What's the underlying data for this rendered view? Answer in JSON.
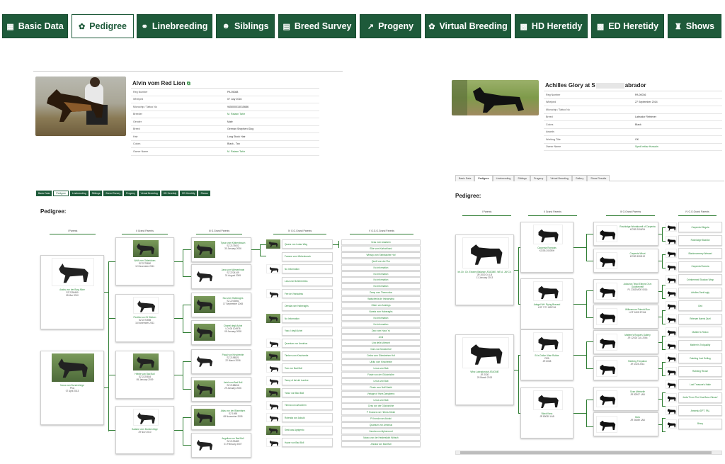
{
  "top_tabs": [
    {
      "label": "Basic Data",
      "icon": "dashboard-icon",
      "active": false
    },
    {
      "label": "Pedigree",
      "icon": "paw-icon",
      "active": true
    },
    {
      "label": "Linebreeding",
      "icon": "link-icon",
      "active": false
    },
    {
      "label": "Siblings",
      "icon": "users-icon",
      "active": false
    },
    {
      "label": "Breed Survey",
      "icon": "book-icon",
      "active": false
    },
    {
      "label": "Progeny",
      "icon": "chart-icon",
      "active": false
    },
    {
      "label": "Virtual Breeding",
      "icon": "paw-icon",
      "active": false
    },
    {
      "label": "HD Heretidy",
      "icon": "sitemap-icon",
      "active": false
    },
    {
      "label": "ED Heretidy",
      "icon": "sitemap-icon",
      "active": false
    },
    {
      "label": "Shows",
      "icon": "trophy-icon",
      "active": false
    }
  ],
  "left": {
    "dog_title": "Alvin vom Red Lion",
    "info": [
      {
        "k": "Reg Number",
        "v": "PA 05088",
        "link": false
      },
      {
        "k": "Whelped",
        "v": "07 July 2016",
        "link": false
      },
      {
        "k": "Microchip / Tattoo No",
        "v": "945000015015686",
        "link": false
      },
      {
        "k": "Breeder",
        "v": "M. Raizan Tahir",
        "link": true
      },
      {
        "k": "Gender",
        "v": "Male",
        "link": false
      },
      {
        "k": "Breed",
        "v": "German Shepherd Dog",
        "link": false
      },
      {
        "k": "Hair",
        "v": "Long Stock Hair",
        "link": false
      },
      {
        "k": "Colors",
        "v": "Black - Tan",
        "link": false
      },
      {
        "k": "Owner Name",
        "v": "M. Raizan Tahir",
        "link": true
      }
    ],
    "tabs": [
      "Basic Data",
      "Pedigree",
      "Linebreeding",
      "Siblings",
      "Breed Survey",
      "Progeny",
      "Virtual Breeding",
      "HD Heretidy",
      "ED Heretidy",
      "Shows"
    ],
    "pedigree_heading": "Pedigree:",
    "gen_labels": [
      "I Parents",
      "II Grand Parents",
      "III G.Grand Parents",
      "IV G.G.Grand Parents",
      "V G.G.G.Grand Parents"
    ],
    "parents": [
      {
        "name": "Arakis von der Burg Mine",
        "line2": "SZ 2290460",
        "line3": "05 Mar 2010"
      },
      {
        "name": "Nona vom Burstenhöge",
        "line2": "PKA",
        "line3": "07 April 2013"
      }
    ],
    "grandparents": [
      {
        "name": "Wolf vom Gtderlohen",
        "line2": "SZ 2275830",
        "line3": "12 December 2011"
      },
      {
        "name": "Perdita von Gt Stinken",
        "line2": "SZ 2274598",
        "line3": "16 November 2011"
      },
      {
        "name": "Hebbe van Bad Boll",
        "line2": "SZ 2220834",
        "line3": "05 January 2009"
      },
      {
        "name": "Sadane vom Burstenhöge",
        "line2": "",
        "line3": "29 Nov 2010"
      }
    ],
    "ggp": [
      {
        "name": "Tyson vom Kibbenbusch",
        "line2": "SZ 2175002",
        "line3": "30 January 2006"
      },
      {
        "name": "Jana vom Wiesenhrain",
        "line2": "SZ 2224149",
        "line3": "31 August 2009"
      },
      {
        "name": "Sax vom Haberaghs",
        "line2": "SZ 2243551",
        "line3": "17 September 2008"
      },
      {
        "name": "Chanel degli Achei",
        "line2": "LOI 08 104976",
        "line3": "05 January 2008"
      },
      {
        "name": "Pacqi von Kirschentie",
        "line2": "SZ 2198521",
        "line3": "22 March 2006"
      },
      {
        "name": "Jadd vom Bad Boll",
        "line2": "SZ 2188616",
        "line3": "29 January 2006"
      },
      {
        "name": "Atlas von der Bilsenfarm",
        "line2": "SZ 1698",
        "line3": "08 November 2005"
      },
      {
        "name": "Angelina von Bad Boll",
        "line2": "SZ 2193489",
        "line3": "01 February 2007"
      }
    ],
    "g4": [
      "Quanz von Lukas Weg",
      "Famme vom Kibbenbusch",
      "No Information",
      "Lana von Bohlenbrinks",
      "Fee de Vinnizalnis",
      "Orestia vom Haberaghs",
      "No Information",
      "Yasu I degli Achei",
      "Quantum von Arminius",
      "Timber vom Kirschentie",
      "Tom von Bad Boll",
      "Tanny of ilai del Lumbre",
      "Yanur von Bad Boll",
      "Tienna von Arboichen",
      "Rotenda von Adouki",
      "Sesti aus Agrigento",
      "Hazar von Bad Boll"
    ],
    "g5": [
      "Uras vom Arasfarm",
      "Elke vom Karlschlossl",
      "Whisky vom Steinbacher Hof",
      "Quelli von der Flur",
      "No Information",
      "No Information",
      "No Information",
      "No Information",
      "Zamp vom Thermodos",
      "Walschenia de Iminarnaha",
      "Olster von Arahegs",
      "Noreta vom Haberaghs",
      "No Information",
      "No Information",
      "Zaro vom Haus Yu",
      "Anni",
      "Uza della Valmont",
      "Dora von Mundorhof",
      "Cedra vom Glimstrehen Hof",
      "Ulcito vom Kirschentie",
      "Lexus von Bab",
      "Fiosie von der Glückshöhe",
      "Lexus von Bab",
      "Fiosie vom Nuff Nabik",
      "Vintage of Yarra Dangberra",
      "Lexus von Bab",
      "Cess von der Glückshöhe",
      "P Krosses von Hebes-Klinke",
      "P Kronda von Adouki",
      "Quantum von Arminius",
      "Xandra von Alphennord",
      "Marzo von der Heiderslicht Wirtsch",
      "Jessica von Bad Boll"
    ]
  },
  "right": {
    "dog_title": "Achilles Glory at S",
    "dog_title_tail": "abrador",
    "info": [
      {
        "k": "Reg Number",
        "v": "PA 00036",
        "link": false
      },
      {
        "k": "Whelped",
        "v": "27 September 2014",
        "link": false
      },
      {
        "k": "Microchip / Tattoo No",
        "v": "",
        "link": false
      },
      {
        "k": "Breed",
        "v": "Labrador Retriever",
        "link": false
      },
      {
        "k": "Colors",
        "v": "Black",
        "link": false
      },
      {
        "k": "Awards",
        "v": "",
        "link": false
      },
      {
        "k": "Working Title",
        "v": "OK",
        "link": false
      },
      {
        "k": "Owner Name",
        "v": "Syed Imtiaz Hussain",
        "link": true
      }
    ],
    "tabs": [
      "Basic Data",
      "Pedigree",
      "Linebreeding",
      "Siblings",
      "Progeny",
      "Virtual Breeding",
      "Gallery",
      "Show Results"
    ],
    "pedigree_heading": "Pedigree:",
    "gen_labels": [
      "I Parents",
      "II Grand Parents",
      "III G.Grand Parents",
      "IV G.G.Grand Parents"
    ],
    "parents": [
      {
        "name": "Int.Ch. Ch. Eboney Balance. ATAGME, WE A. JW Ch.",
        "line2": "JR 2030 D LLB",
        "line3": "11 January 2013"
      },
      {
        "name": "Winz Labradorclub ATAGME",
        "line2": "JR 2030",
        "line3": "25 March 2013"
      }
    ],
    "grandparents": [
      {
        "name": "Carpenta Romanis",
        "line2": "KCSB 2003RH",
        "line3": ""
      },
      {
        "name": "Adegal We' Flying Bravard",
        "line2": "LOF 7/71 WRC16",
        "line3": ""
      },
      {
        "name": "Eu's Dollar Lilian Rubbe",
        "line2": "DPA",
        "line3": "JR 6008"
      },
      {
        "name": "Black Kass",
        "line2": "JR 80030 LAB",
        "line3": ""
      }
    ],
    "ggp": [
      {
        "name": "Rushlodge Wuntakomfi of Carpenta",
        "line2": "KCSB 2004RH",
        "line3": ""
      },
      {
        "name": "Carpenta Wisnt",
        "line2": "KCSB 3002HO",
        "line3": ""
      },
      {
        "name": "Adouhon Tekoi Ebbyni Of-m Goldherveth",
        "line2": "PL 2302/MOE 0016",
        "line3": ""
      },
      {
        "name": "Wilkesmore Primold Bon",
        "line2": "LOF 1605 57154",
        "line3": ""
      },
      {
        "name": "Mattern's Rogue's Gallery",
        "line2": "JR 12024 JUL 2064",
        "line3": ""
      },
      {
        "name": "Rabbing Timpation",
        "line2": "JR 1024 2014",
        "line3": ""
      },
      {
        "name": "Svan Aftelvelle",
        "line2": "JR 82907 LAB",
        "line3": ""
      },
      {
        "name": "Bola",
        "line2": "JR 04089 LAB",
        "line3": ""
      }
    ],
    "g4": [
      "Carpenta Gibgula",
      "Rushlodge Bazidot",
      "Blackmomerey Weswel",
      "Carpenta Romnia",
      "Crimbermed Shadow Wrap",
      "Artolles Dark Ingly",
      "Ged",
      "Relenae Naeris Quel",
      "Mattern's Redox",
      "Mattern's Trolquality",
      "Dabbing Just Gelling",
      "Rabbing Reuse",
      "Lost Treasure's Katie",
      "Joida 'Prom The Kina Bess Ginsen'",
      "Amnesia DPT. FAL",
      "Binny"
    ]
  }
}
